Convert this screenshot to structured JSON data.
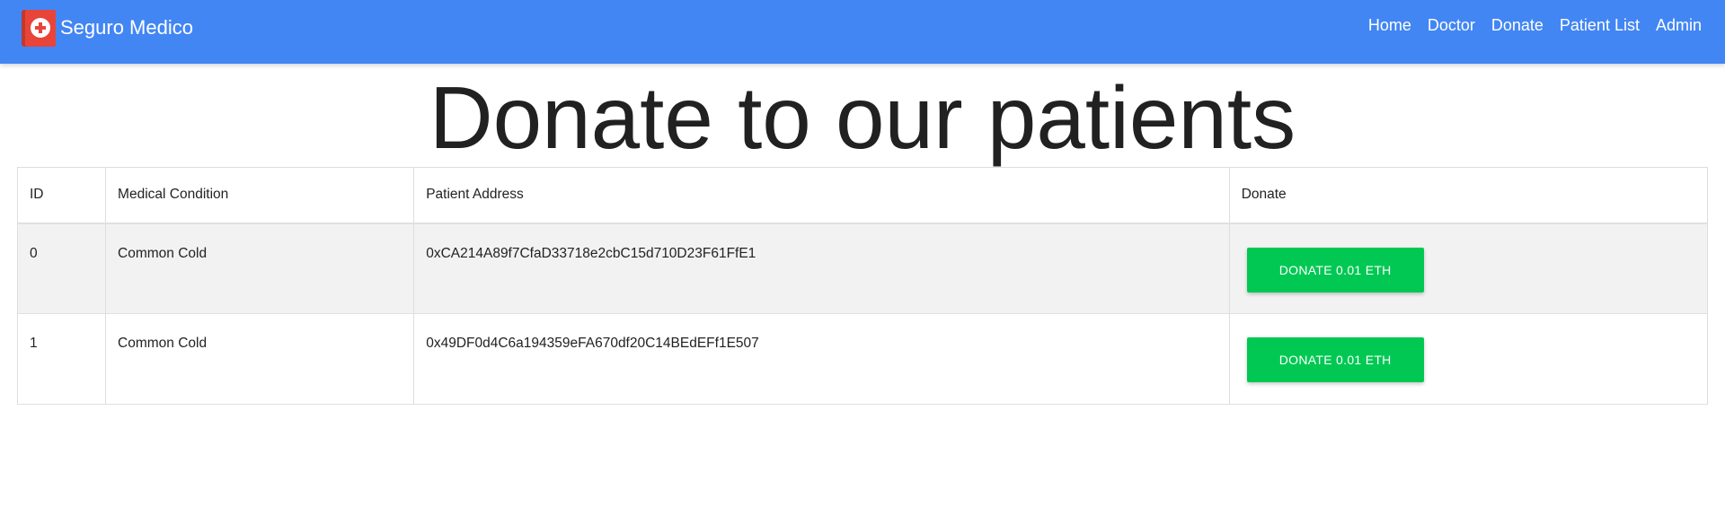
{
  "navbar": {
    "brand": "Seguro Medico",
    "links": [
      "Home",
      "Doctor",
      "Donate",
      "Patient List",
      "Admin"
    ],
    "background": "#4286f4"
  },
  "page": {
    "title": "Donate to our patients"
  },
  "table": {
    "headers": [
      "ID",
      "Medical Condition",
      "Patient Address",
      "Donate"
    ],
    "rows": [
      {
        "id": "0",
        "condition": "Common Cold",
        "address": "0xCA214A89f7CfaD33718e2cbC15d710D23F61FfE1",
        "button": "DONATE 0.01 ETH"
      },
      {
        "id": "1",
        "condition": "Common Cold",
        "address": "0x49DF0d4C6a194359eFA670df20C14BEdEFf1E507",
        "button": "DONATE 0.01 ETH"
      }
    ]
  },
  "colors": {
    "donate_button": "#00c853",
    "striped_row": "#f2f2f2",
    "logo": "#e8443a"
  },
  "icons": {
    "brand_logo": "medical-cross-icon"
  }
}
